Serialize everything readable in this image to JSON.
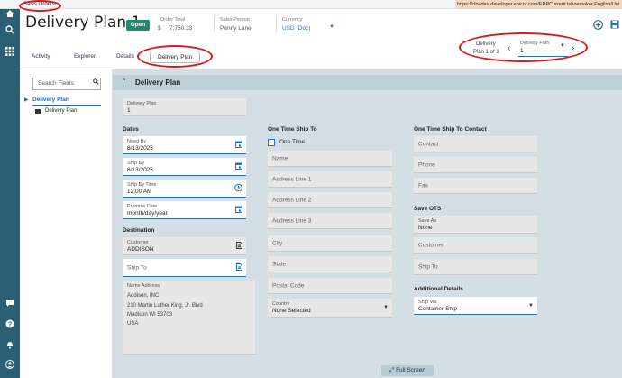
{
  "topbar": {
    "breadcrumb": "Sales Orders",
    "breadcrumb_arrow": "›",
    "info": "https://cloudea.developer.epicor.com/ERPCurrent   tshoemaker   English/Uni"
  },
  "nav": {
    "icons": [
      "home-icon",
      "search-icon",
      "apps-grid-icon",
      "chat-icon",
      "help-icon",
      "notifications-icon",
      "user-icon"
    ]
  },
  "header": {
    "title": "Delivery Plan 1",
    "status": "Open",
    "order_total_label": "Order Total",
    "order_total_currency": "$",
    "order_total_value": "7,750.33",
    "sales_person_label": "Sales Person",
    "sales_person_value": "Penny Lane",
    "currency_label": "Currency",
    "currency_value": "USD (Doc)",
    "add_icon": "+",
    "save_icon": "▣"
  },
  "pager": {
    "label_line1": "Delivery",
    "label_line2": "Plan 1 of 3",
    "prev": "‹",
    "next": "›",
    "select_label": "Delivery Plan",
    "select_value": "1"
  },
  "tabs": [
    {
      "label": "Activity"
    },
    {
      "label": "Explorer"
    },
    {
      "label": "Details"
    },
    {
      "label": "Delivery Plan"
    }
  ],
  "sidebar": {
    "search_placeholder": "Search Fields",
    "tree_root": "Delivery Plan",
    "tree_child": "Delivery Plan"
  },
  "panel": {
    "title": "Delivery Plan",
    "delivery_plan_label": "Delivery Plan",
    "delivery_plan_value": "1",
    "dates": {
      "heading": "Dates",
      "need_by_label": "Need By",
      "need_by_value": "8/13/2025",
      "ship_by_label": "Ship By",
      "ship_by_value": "8/13/2025",
      "ship_by_time_label": "Ship By Time",
      "ship_by_time_value": "12:00 AM",
      "promise_label": "Promise Date",
      "promise_value": "month/day/year"
    },
    "destination": {
      "heading": "Destination",
      "customer_label": "Customer",
      "customer_value": "ADDISON",
      "ship_to_placeholder": "Ship To",
      "name_address_label": "Name Address",
      "address_lines": [
        "Addison, INC",
        "210 Martin Luther King, Jr. Blvd",
        "Madison WI 53703",
        "USA"
      ]
    },
    "one_time": {
      "heading": "One Time Ship To",
      "checkbox_label": "One Time",
      "fields": [
        "Name",
        "Address Line 1",
        "Address Line 2",
        "Address Line 3",
        "City",
        "State",
        "Postal Code"
      ],
      "country_label": "Country",
      "country_value": "None Selected"
    },
    "contact": {
      "heading": "One Time Ship To Contact",
      "fields": [
        "Contact",
        "Phone",
        "Fax"
      ]
    },
    "save_ots": {
      "heading": "Save OTS",
      "save_as_label": "Save As",
      "save_as_value": "None",
      "fields": [
        "Customer",
        "Ship To"
      ]
    },
    "additional": {
      "heading": "Additional Details",
      "ship_via_label": "Ship Via",
      "ship_via_value": "Container Ship"
    }
  },
  "footer": {
    "full_screen": "Full Screen"
  },
  "colors": {
    "nav": "#2b5f73",
    "accent": "#2a6db5",
    "open_badge": "#1d8b6f",
    "panel_bg": "#d3dfe4",
    "annotation": "#d61b1b"
  }
}
